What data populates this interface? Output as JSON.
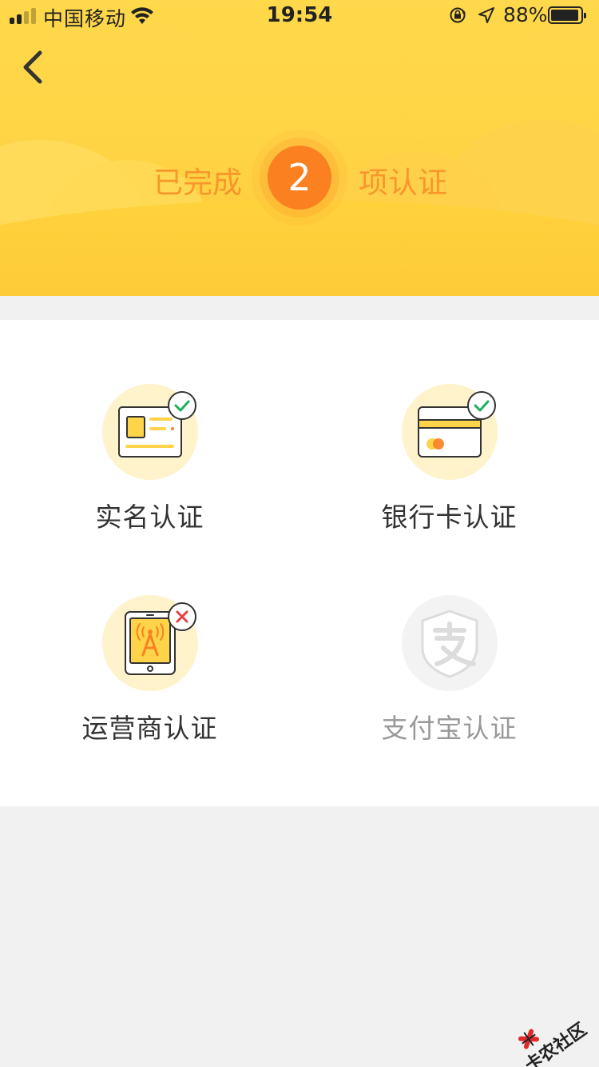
{
  "status_bar": {
    "carrier": "中国移动",
    "time": "19:54",
    "battery_percent": "88%"
  },
  "header": {
    "summary_prefix": "已完成",
    "completed_count": "2",
    "summary_suffix": "项认证",
    "back_icon": "chevron-left-icon"
  },
  "verifications": [
    {
      "label": "实名认证",
      "icon": "id-card-icon",
      "status": "verified"
    },
    {
      "label": "银行卡认证",
      "icon": "bank-card-icon",
      "status": "verified"
    },
    {
      "label": "运营商认证",
      "icon": "carrier-phone-icon",
      "status": "failed"
    },
    {
      "label": "支付宝认证",
      "icon": "alipay-icon",
      "status": "disabled"
    }
  ],
  "watermark": "卡农社区",
  "colors": {
    "header_yellow": "#ffd545",
    "accent_orange": "#fa8020",
    "summary_text": "#f9962c",
    "check_green": "#1fae5b",
    "cross_red": "#e84040"
  }
}
